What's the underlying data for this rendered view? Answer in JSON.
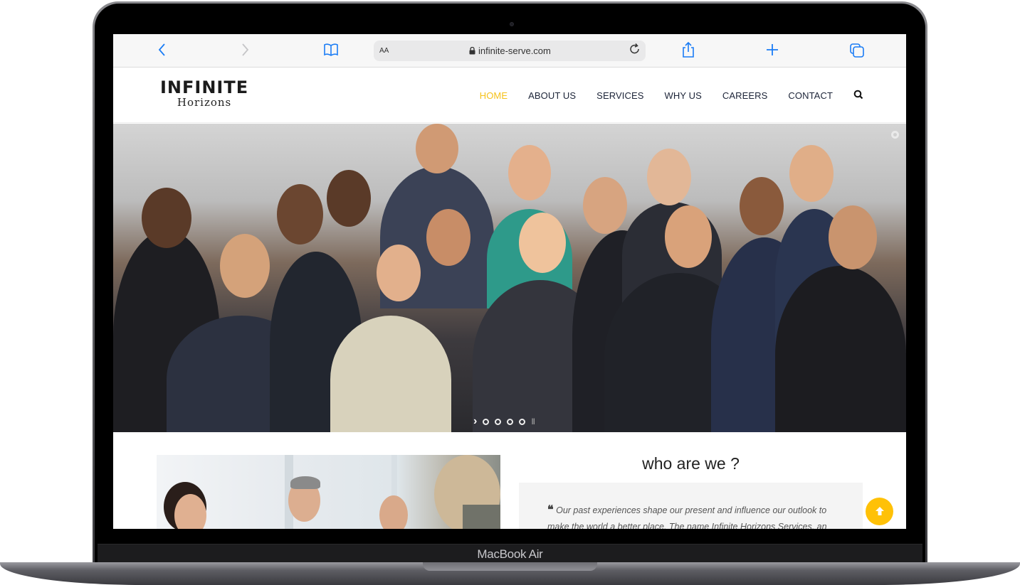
{
  "device": {
    "label": "MacBook Air"
  },
  "browser": {
    "text_size_label": "AA",
    "url": "infinite-serve.com",
    "icons": {
      "back": "chevron-left-icon",
      "forward": "chevron-right-icon",
      "bookmarks": "book-icon",
      "lock": "lock-icon",
      "reload": "reload-icon",
      "share": "share-icon",
      "new_tab": "plus-icon",
      "tabs": "tabs-icon"
    }
  },
  "site": {
    "logo": {
      "line1": "INFINITE",
      "line2": "Horizons"
    },
    "nav": [
      {
        "label": "HOME",
        "active": true
      },
      {
        "label": "ABOUT US",
        "active": false
      },
      {
        "label": "SERVICES",
        "active": false
      },
      {
        "label": "WHY US",
        "active": false
      },
      {
        "label": "CAREERS",
        "active": false
      },
      {
        "label": "CONTACT",
        "active": false
      }
    ],
    "search_icon": "search-icon",
    "accent_color": "#f5c21b",
    "hero": {
      "slide_count": 4,
      "next_glyph": "›",
      "pause_glyph": "II"
    },
    "about": {
      "title": "who are we ?",
      "quote_mark": "❝",
      "quote": "Our past experiences shape our present and influence our outlook to make the world a better place. The name Infinite Horizons Services, an"
    },
    "back_to_top_icon": "arrow-up-icon"
  }
}
